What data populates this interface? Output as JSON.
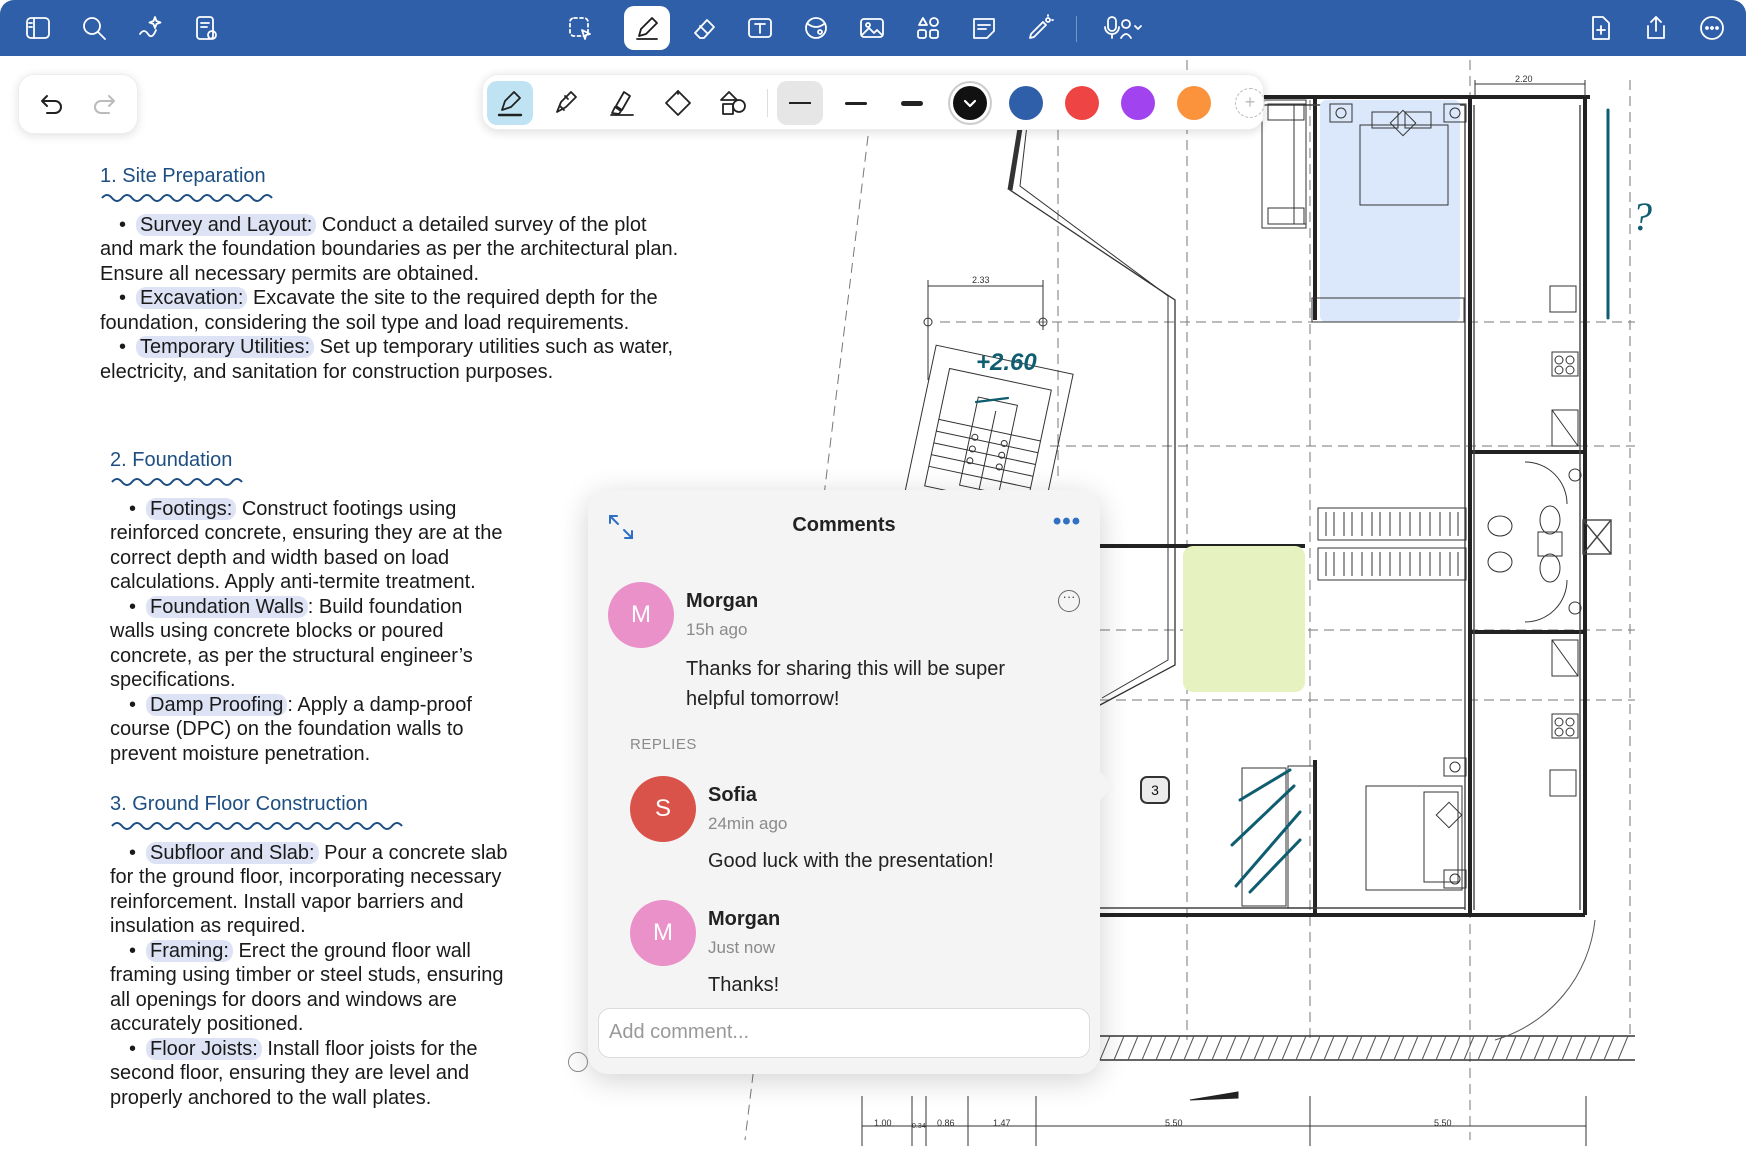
{
  "toolbar": {
    "left_icons": [
      "sidebar-icon",
      "search-icon",
      "ai-sparkle-icon",
      "notes-settings-icon"
    ],
    "center_icons": [
      "lasso-select-icon",
      "pen-icon",
      "eraser-icon",
      "text-box-icon",
      "shapes-icon",
      "image-icon",
      "elements-icon",
      "sticky-note-icon",
      "laser-pointer-icon",
      "audio-record-icon"
    ],
    "right_icons": [
      "add-page-icon",
      "share-icon",
      "more-icon"
    ],
    "active_tool": "pen-icon"
  },
  "pen_toolbar": {
    "tools": [
      "fountain-pen",
      "brush-pen",
      "highlighter",
      "ruler-shape",
      "shape-recognition"
    ],
    "active_tool": "fountain-pen",
    "thicknesses": [
      "thin",
      "medium",
      "thick"
    ],
    "selected_thickness": "thin",
    "colors": [
      "#111111",
      "#2f5fa8",
      "#ef4444",
      "#a243f0",
      "#fb923c"
    ],
    "selected_color": "#111111"
  },
  "document": {
    "sections": [
      {
        "heading": "1. Site Preparation",
        "items": [
          {
            "label": "Survey and Layout:",
            "text": " Conduct a detailed survey of the plot",
            "cont": [
              "and mark the foundation boundaries as per the architectural plan.",
              "Ensure all necessary permits are obtained."
            ]
          },
          {
            "label": "Excavation:",
            "text": " Excavate the site to the required depth for the",
            "cont": [
              "foundation, considering the soil type and load requirements."
            ]
          },
          {
            "label": "Temporary Utilities:",
            "text": " Set up temporary utilities such as water,",
            "cont": [
              "electricity, and sanitation for construction purposes."
            ]
          }
        ]
      },
      {
        "heading": "2. Foundation",
        "items": [
          {
            "label": "Footings:",
            "text": " Construct footings using",
            "cont": [
              "reinforced concrete, ensuring they are at the",
              "correct depth and width based on load",
              "calculations. Apply anti-termite treatment."
            ]
          },
          {
            "label": "Foundation Walls",
            "text": ": Build foundation",
            "cont": [
              "walls using concrete blocks or poured",
              "concrete, as per the structural engineer’s",
              "specifications."
            ]
          },
          {
            "label": "Damp Proofing",
            "text": ": Apply a damp-proof",
            "cont": [
              "course (DPC) on the foundation walls to",
              "prevent moisture penetration."
            ]
          }
        ]
      },
      {
        "heading": "3. Ground Floor Construction",
        "items": [
          {
            "label": "Subfloor and Slab:",
            "text": " Pour a concrete slab",
            "cont": [
              "for the ground floor, incorporating necessary",
              "reinforcement. Install vapor barriers and",
              "insulation as required."
            ]
          },
          {
            "label": "Framing:",
            "text": " Erect the ground floor wall",
            "cont": [
              "framing using timber or steel studs, ensuring",
              "all openings for doors and windows are",
              "accurately positioned."
            ]
          },
          {
            "label": "Floor Joists:",
            "text": " Install floor joists for the",
            "cont": [
              "second floor, ensuring they are level and",
              "properly anchored to the wall plates."
            ]
          }
        ]
      }
    ]
  },
  "comments": {
    "title": "Comments",
    "replies_label": "REPLIES",
    "input_placeholder": "Add comment...",
    "main": {
      "initial": "M",
      "author": "Morgan",
      "time": "15h ago",
      "text_line1": "Thanks for sharing this will be super",
      "text_line2": "helpful tomorrow!",
      "avatar_color": "#e991c8"
    },
    "replies": [
      {
        "initial": "S",
        "author": "Sofia",
        "time": "24min ago",
        "text": "Good luck with the presentation!",
        "avatar_color": "#d9534a"
      },
      {
        "initial": "M",
        "author": "Morgan",
        "time": "Just now",
        "text": "Thanks!",
        "avatar_color": "#e991c8"
      }
    ]
  },
  "plan": {
    "dims": {
      "d1": "2.20",
      "d2": "2.33",
      "d3": "1.00",
      "d4": "0.34",
      "d5": "0.86",
      "d6": "1.47",
      "d7": "5.50",
      "d8": "5.50",
      "d9": "2.60"
    },
    "handwritten_level": "+2.60",
    "handwritten_question": "?",
    "comment_badge_count": "3"
  }
}
